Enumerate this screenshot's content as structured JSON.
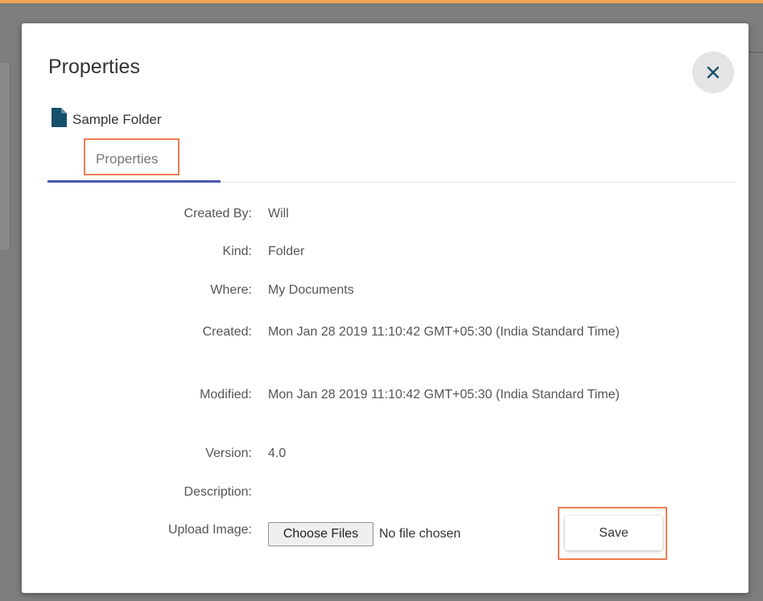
{
  "dialog": {
    "title": "Properties",
    "close_icon": "close-icon",
    "file_icon": "document-icon",
    "folder_name": "Sample Folder",
    "tab_label": "Properties"
  },
  "properties": {
    "created_by_label": "Created By:",
    "created_by_value": "Will",
    "kind_label": "Kind:",
    "kind_value": "Folder",
    "where_label": "Where:",
    "where_value": "My Documents",
    "created_label": "Created:",
    "created_value": "Mon Jan 28 2019 11:10:42 GMT+05:30 (India Standard Time)",
    "modified_label": "Modified:",
    "modified_value": "Mon Jan 28 2019 11:10:42 GMT+05:30 (India Standard Time)",
    "version_label": "Version:",
    "version_value": "4.0",
    "description_label": "Description:",
    "upload_label": "Upload Image:"
  },
  "upload": {
    "choose_button": "Choose Files",
    "status": "No file chosen"
  },
  "actions": {
    "save_label": "Save"
  },
  "colors": {
    "accent": "#4a55b0",
    "highlight": "#f07c52",
    "icon": "#16506a"
  }
}
